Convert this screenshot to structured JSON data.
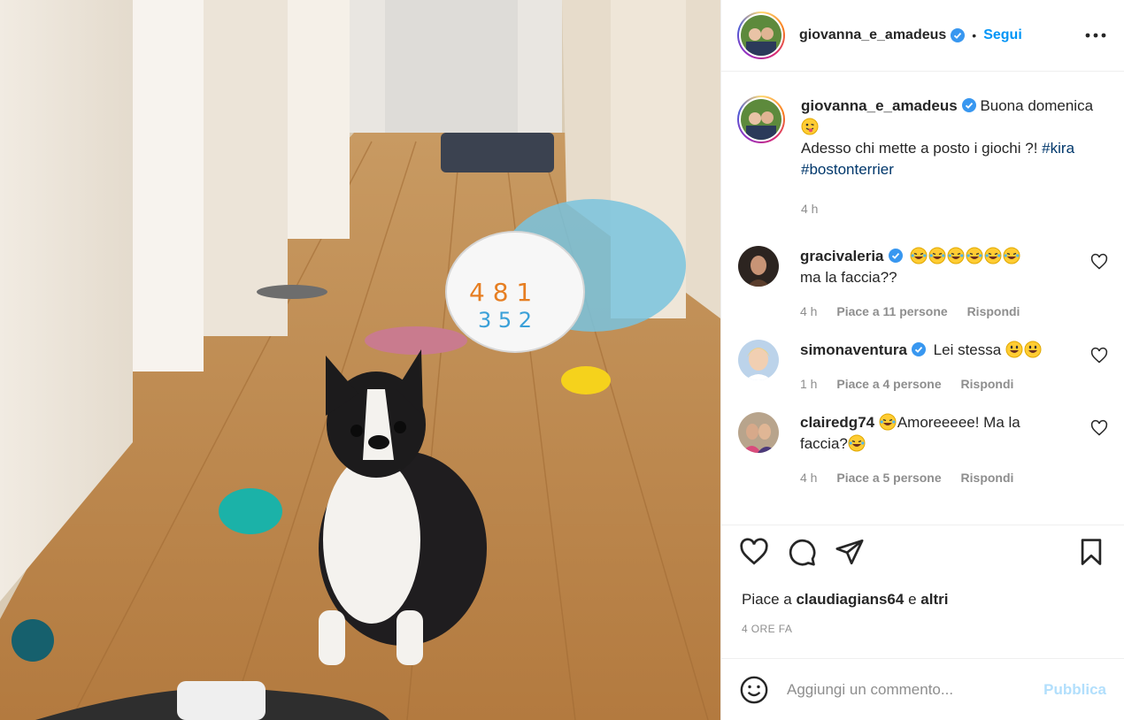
{
  "post": {
    "author": "giovanna_e_amadeus",
    "follow_label": "Segui",
    "separator": "•",
    "caption_line1": "Buona domenica",
    "caption_line2": "Adesso chi mette a posto i giochi ?!",
    "hashtags": [
      "#kira",
      "#bostonterrier"
    ],
    "caption_time": "4 h",
    "photo_icons": [
      "boston-terrier-dog",
      "toy-balls",
      "laundry-hamper"
    ]
  },
  "comments": [
    {
      "user": "gracivaleria",
      "verified": true,
      "emoji_count": 6,
      "text": "ma la faccia??",
      "time": "4 h",
      "likes": "Piace a 11 persone",
      "reply": "Rispondi"
    },
    {
      "user": "simonaventura",
      "verified": true,
      "text": "Lei stessa",
      "emoji_count": 2,
      "time": "1 h",
      "likes": "Piace a 4 persone",
      "reply": "Rispondi"
    },
    {
      "user": "clairedg74",
      "verified": false,
      "text_a": "Amoreeeee! Ma la",
      "text_b": "faccia?",
      "time": "4 h",
      "likes": "Piace a 5 persone",
      "reply": "Rispondi"
    }
  ],
  "likes_summary": {
    "prefix": "Piace a",
    "user": "claudiagians64",
    "suffix": "e",
    "others": "altri"
  },
  "timestamp": "4 ORE FA",
  "add_comment": {
    "placeholder": "Aggiungi un commento...",
    "publish": "Pubblica"
  },
  "colors": {
    "accent": "#0095f6",
    "hashtag": "#00376b",
    "muted": "#8e8e8e",
    "publish_disabled": "#b2dffc",
    "verified": "#3897f0"
  }
}
